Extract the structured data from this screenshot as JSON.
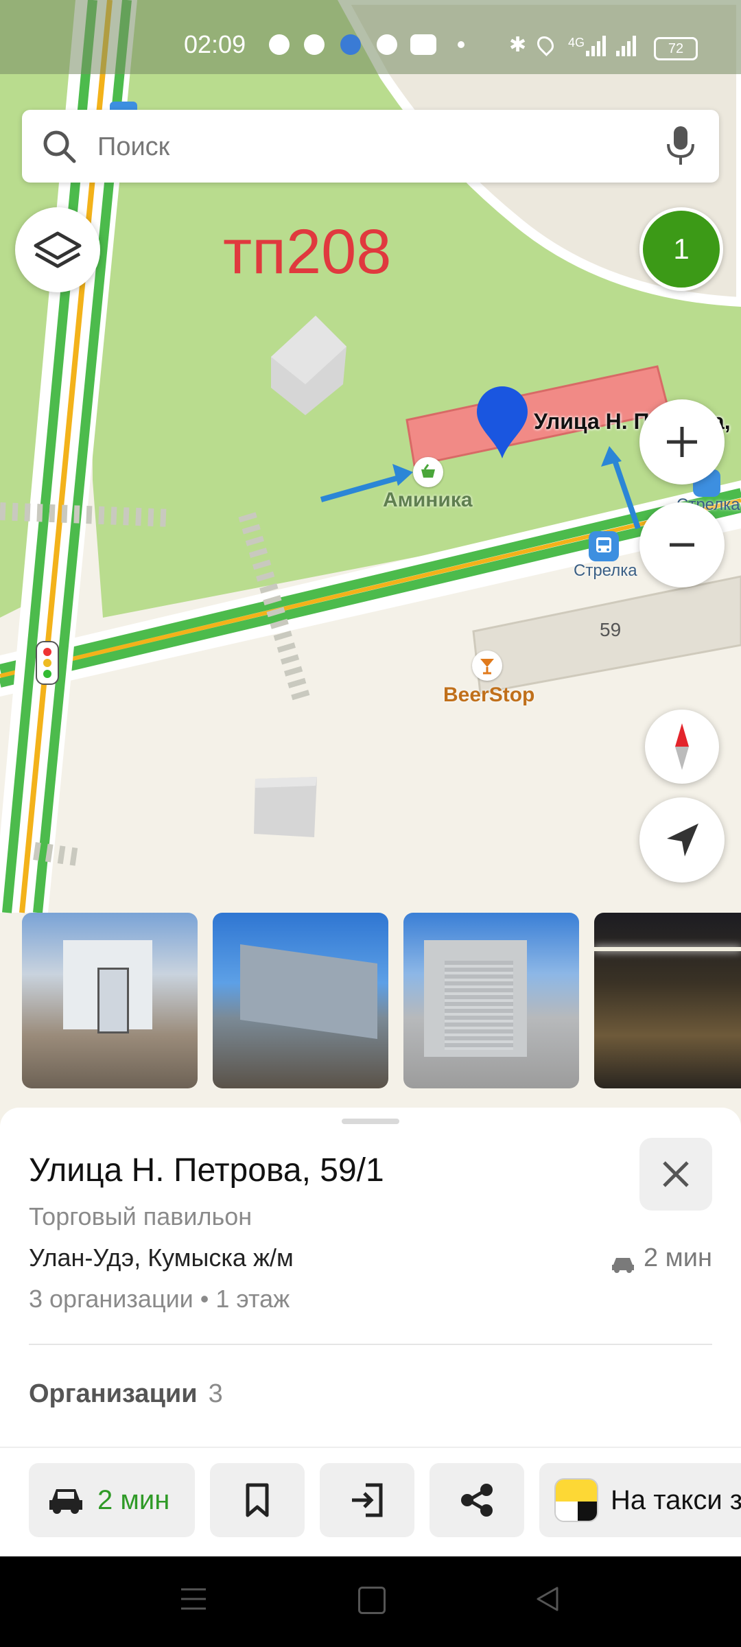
{
  "status_bar": {
    "time": "02:09",
    "network": "4G",
    "battery": "72"
  },
  "search": {
    "placeholder": "Поиск"
  },
  "map": {
    "overlay_text": "тп208",
    "badge_count": "1",
    "labels": {
      "building_name": "Улица Н. Петрова,",
      "shop1": "Аминика",
      "bus_stop1": "Стрелка",
      "bus_stop2": "Стрелка",
      "house_number": "59",
      "bar": "BeerStop"
    }
  },
  "place": {
    "title": "Улица Н. Петрова, 59/1",
    "subtitle": "Торговый павильон",
    "address": "Улан-Удэ, Кумыска ж/м",
    "meta": "3 организации • 1 этаж",
    "travel_time": "2 мин"
  },
  "organizations": {
    "label": "Организации",
    "count": "3"
  },
  "actions": {
    "route_time": "2 мин",
    "taxi": "На такси з"
  },
  "colors": {
    "accent_green": "#2f9a27",
    "badge_green": "#3c9a17",
    "pin_blue": "#1a56e0",
    "road_green": "#4cbb4c",
    "road_yellow": "#f3b21a"
  }
}
